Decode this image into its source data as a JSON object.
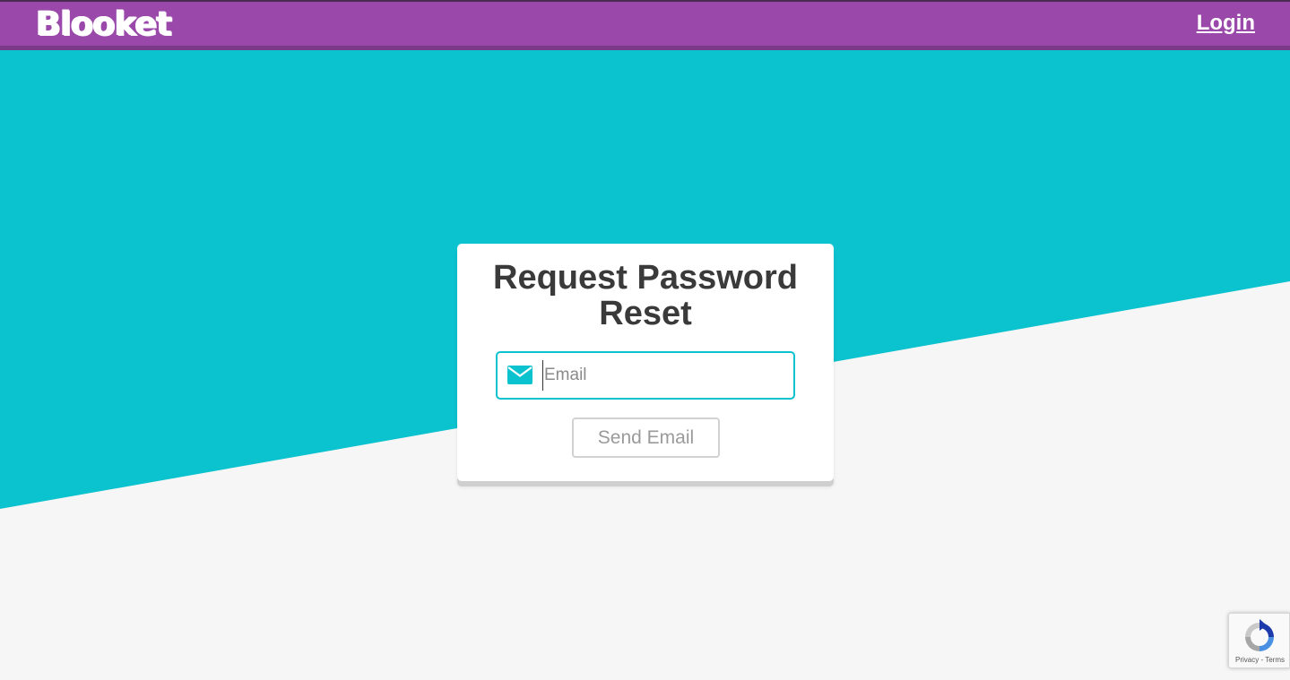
{
  "header": {
    "logo_text": "Blooket",
    "login_label": "Login"
  },
  "card": {
    "title": "Request Password Reset",
    "email_placeholder": "Email",
    "email_value": "",
    "send_button_label": "Send Email"
  },
  "recaptcha": {
    "privacy_label": "Privacy",
    "separator": " - ",
    "terms_label": "Terms"
  },
  "colors": {
    "header_bg": "#9a49aa",
    "accent_teal": "#0bc2cf",
    "page_bg": "#f6f6f6",
    "card_bg": "#ffffff",
    "title_text": "#3a3a3a"
  },
  "icons": {
    "email_field_icon": "envelope-icon",
    "recaptcha_icon": "recaptcha-icon"
  }
}
